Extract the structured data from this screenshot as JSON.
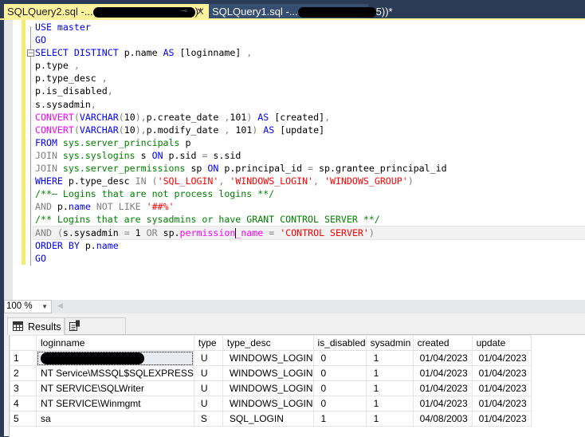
{
  "tabs": [
    {
      "label_prefix": "SQLQuery2.sql -...",
      "label_suffix": ")*",
      "active": true,
      "pin_icon": "⊸",
      "close_icon": "✕"
    },
    {
      "label_prefix": "SQLQuery1.sql -...",
      "label_suffix": "5))*",
      "active": false
    }
  ],
  "editor": {
    "lines": [
      [
        {
          "t": "USE",
          "c": "kw"
        },
        {
          "t": " master",
          "c": "kw"
        }
      ],
      [
        {
          "t": "GO",
          "c": "kw"
        }
      ],
      [
        {
          "t": "SELECT",
          "c": "kw"
        },
        {
          "t": " "
        },
        {
          "t": "DISTINCT",
          "c": "kw"
        },
        {
          "t": " p.name "
        },
        {
          "t": "AS",
          "c": "kw"
        },
        {
          "t": " [loginname] "
        },
        {
          "t": ",",
          "c": "gray"
        }
      ],
      [
        {
          "t": "p.type "
        },
        {
          "t": ",",
          "c": "gray"
        }
      ],
      [
        {
          "t": "p.type_desc "
        },
        {
          "t": ",",
          "c": "gray"
        }
      ],
      [
        {
          "t": "p.is_disabled"
        },
        {
          "t": ",",
          "c": "gray"
        }
      ],
      [
        {
          "t": "s.sysadmin"
        },
        {
          "t": ",",
          "c": "gray"
        }
      ],
      [
        {
          "t": "CONVERT",
          "c": "fn"
        },
        {
          "t": "(",
          "c": "gray"
        },
        {
          "t": "VARCHAR",
          "c": "kw"
        },
        {
          "t": "(",
          "c": "gray"
        },
        {
          "t": "10"
        },
        {
          "t": "),",
          "c": "gray"
        },
        {
          "t": "p.create_date "
        },
        {
          "t": ",",
          "c": "gray"
        },
        {
          "t": "101"
        },
        {
          "t": ")",
          "c": "gray"
        },
        {
          "t": " "
        },
        {
          "t": "AS",
          "c": "kw"
        },
        {
          "t": " [created]"
        },
        {
          "t": ",",
          "c": "gray"
        }
      ],
      [
        {
          "t": "CONVERT",
          "c": "fn"
        },
        {
          "t": "(",
          "c": "gray"
        },
        {
          "t": "VARCHAR",
          "c": "kw"
        },
        {
          "t": "(",
          "c": "gray"
        },
        {
          "t": "10"
        },
        {
          "t": "),",
          "c": "gray"
        },
        {
          "t": "p.modify_date "
        },
        {
          "t": ",",
          "c": "gray"
        },
        {
          "t": " 101"
        },
        {
          "t": ")",
          "c": "gray"
        },
        {
          "t": " "
        },
        {
          "t": "AS",
          "c": "kw"
        },
        {
          "t": " [update]"
        }
      ],
      [
        {
          "t": "FROM",
          "c": "kw"
        },
        {
          "t": " "
        },
        {
          "t": "sys.server_principals",
          "c": "sys"
        },
        {
          "t": " p"
        }
      ],
      [
        {
          "t": "JOIN",
          "c": "gray"
        },
        {
          "t": " "
        },
        {
          "t": "sys.syslogins",
          "c": "sys"
        },
        {
          "t": " s "
        },
        {
          "t": "ON",
          "c": "kw"
        },
        {
          "t": " p.sid "
        },
        {
          "t": "=",
          "c": "gray"
        },
        {
          "t": " s.sid"
        }
      ],
      [
        {
          "t": "JOIN",
          "c": "gray"
        },
        {
          "t": " "
        },
        {
          "t": "sys.server_permissions",
          "c": "sys"
        },
        {
          "t": " sp "
        },
        {
          "t": "ON",
          "c": "kw"
        },
        {
          "t": " p.principal_id "
        },
        {
          "t": "=",
          "c": "gray"
        },
        {
          "t": " sp.grantee_principal_id"
        }
      ],
      [
        {
          "t": "WHERE",
          "c": "kw"
        },
        {
          "t": " p.type_desc "
        },
        {
          "t": "IN",
          "c": "gray"
        },
        {
          "t": " "
        },
        {
          "t": "(",
          "c": "gray"
        },
        {
          "t": "'SQL_LOGIN'",
          "c": "str"
        },
        {
          "t": ", ",
          "c": "gray"
        },
        {
          "t": "'WINDOWS_LOGIN'",
          "c": "str"
        },
        {
          "t": ", ",
          "c": "gray"
        },
        {
          "t": "'WINDOWS_GROUP'",
          "c": "str"
        },
        {
          "t": ")",
          "c": "gray"
        }
      ],
      [
        {
          "t": "/**— Logins that are not process logins **/",
          "c": "cmt"
        }
      ],
      [
        {
          "t": "AND",
          "c": "gray"
        },
        {
          "t": " p."
        },
        {
          "t": "name",
          "c": "kw"
        },
        {
          "t": " "
        },
        {
          "t": "NOT LIKE",
          "c": "gray"
        },
        {
          "t": " "
        },
        {
          "t": "'##%'",
          "c": "str"
        }
      ],
      [
        {
          "t": "/** Logins that are sysadmins or have GRANT CONTROL SERVER **/",
          "c": "cmt"
        }
      ],
      [
        {
          "t": "AND",
          "c": "gray"
        },
        {
          "t": " "
        },
        {
          "t": "(",
          "c": "gray"
        },
        {
          "t": "s.sysadmin "
        },
        {
          "t": "=",
          "c": "gray"
        },
        {
          "t": " 1 "
        },
        {
          "t": "OR",
          "c": "gray"
        },
        {
          "t": " sp."
        },
        {
          "t": "permission",
          "c": "fn"
        },
        {
          "t": "|caret|"
        },
        {
          "t": "_name",
          "c": "fn"
        },
        {
          "t": " "
        },
        {
          "t": "=",
          "c": "gray"
        },
        {
          "t": " "
        },
        {
          "t": "'CONTROL SERVER'",
          "c": "str"
        },
        {
          "t": ")",
          "c": "gray"
        }
      ],
      [
        {
          "t": "ORDER BY",
          "c": "kw"
        },
        {
          "t": " p."
        },
        {
          "t": "name",
          "c": "kw"
        }
      ],
      [
        {
          "t": "GO",
          "c": "kw"
        }
      ]
    ],
    "current_line": 16
  },
  "zoom": {
    "value": "100 %"
  },
  "results_tabs": [
    {
      "label": "Results",
      "icon": "grid-icon"
    },
    {
      "label": "Messages",
      "icon": "messages-icon"
    }
  ],
  "grid": {
    "columns": [
      "loginname",
      "type",
      "type_desc",
      "is_disabled",
      "sysadmin",
      "created",
      "update"
    ],
    "rows": [
      {
        "num": "1",
        "cells": [
          "",
          "U",
          "WINDOWS_LOGIN",
          "0",
          "1",
          "01/04/2023",
          "01/04/2023"
        ],
        "redacted": true
      },
      {
        "num": "2",
        "cells": [
          "NT Service\\MSSQL$SQLEXPRESS",
          "U",
          "WINDOWS_LOGIN",
          "0",
          "1",
          "01/04/2023",
          "01/04/2023"
        ]
      },
      {
        "num": "3",
        "cells": [
          "NT SERVICE\\SQLWriter",
          "U",
          "WINDOWS_LOGIN",
          "0",
          "1",
          "01/04/2023",
          "01/04/2023"
        ]
      },
      {
        "num": "4",
        "cells": [
          "NT SERVICE\\Winmgmt",
          "U",
          "WINDOWS_LOGIN",
          "0",
          "1",
          "01/04/2023",
          "01/04/2023"
        ]
      },
      {
        "num": "5",
        "cells": [
          "sa",
          "S",
          "SQL_LOGIN",
          "1",
          "1",
          "04/08/2003",
          "01/04/2023"
        ]
      }
    ]
  }
}
